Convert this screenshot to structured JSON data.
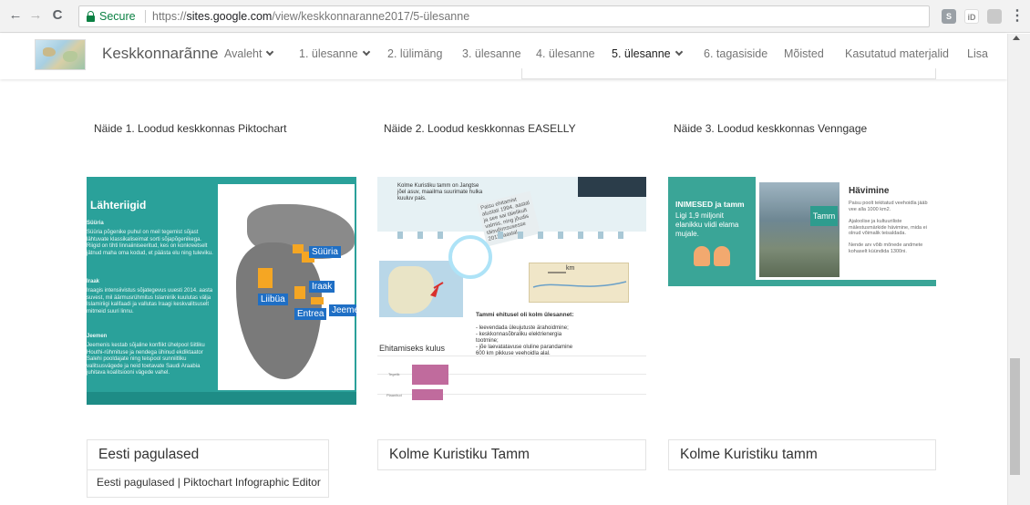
{
  "browser": {
    "back_glyph": "←",
    "forward_glyph": "→",
    "reload_glyph": "C",
    "secure_label": "Secure",
    "url_scheme": "https://",
    "url_host": "sites.google.com",
    "url_path": "/view/keskkonnaranne2017/5-ülesanne",
    "star_glyph": "☆",
    "ext1_label": "S",
    "ext2_label": "iD",
    "ext3_label": "",
    "menu_glyph": "⋮"
  },
  "site": {
    "title": "Keskkonnarãnne",
    "nav": [
      {
        "label": "Avaleht",
        "has_dropdown": true
      },
      {
        "label": "1. ülesanne",
        "has_dropdown": true
      },
      {
        "label": "2. lülimäng",
        "has_dropdown": false
      },
      {
        "label": "3. ülesanne",
        "has_dropdown": false
      },
      {
        "label": "4. ülesanne",
        "has_dropdown": false
      },
      {
        "label": "5. ülesanne",
        "has_dropdown": true,
        "active": true
      },
      {
        "label": "6. tagasiside",
        "has_dropdown": false
      },
      {
        "label": "Mõisted",
        "has_dropdown": false
      },
      {
        "label": "Kasutatud materjalid",
        "has_dropdown": false
      },
      {
        "label": "Lisa",
        "has_dropdown": false
      }
    ]
  },
  "examples": [
    {
      "caption": "Näide 1. Loodud keskkonnas Piktochart",
      "card_title": "Eesti pagulased",
      "card_subtitle": "Eesti pagulased | Piktochart Infographic Editor"
    },
    {
      "caption": "Näide 2. Loodud keskkonnas EASELLY",
      "card_title": "Kolme Kuristiku Tamm"
    },
    {
      "caption": "Näide 3. Loodud keskkonnas Venngage",
      "card_title": "Kolme Kuristiku tamm"
    }
  ],
  "infographic1": {
    "heading": "Lähteriigid",
    "sections": [
      {
        "title": "Süüria",
        "text": "Süüria põgenike puhul on meil tegemist sõjast lähtuvate klassikaliseimat sorti sõjapõgenikega. Riigid on tihti linnaiiniseeritud, kes on konkreetselt jätnud maha oma kodud, et päästa elu ning tuleviku."
      },
      {
        "title": "Iraak",
        "text": "Iraagis intensiivistus sõjategevus uuesti 2014. aasta suvest, mil äärmusrühmitus Islamiriik kuulutas välja Islamiriigi kalifaadi ja vallutas Iraagi keskvalitsuselt mitmeid suuri linnu."
      },
      {
        "title": "Jeemen",
        "text": "Jeemenis kestab sõjaline konflikt ühelpool šiitliku Houthi-rühmituse ja nendega ühinud ekdiktaator Salehi pooldajate ning teispool sunniitliku valitsusvägede ja neid toetavate Saudi Araabia juhitava koalitsiooni vägede vahel."
      }
    ],
    "map_labels": [
      "Süüria",
      "Iraak",
      "Liibüa",
      "Entrea",
      "Jeemen"
    ]
  },
  "infographic2": {
    "top_text": "Kolme Kuristiku tamm on Jangtse jõel asuv, maailma suurimate hulka kuuluv pais.",
    "note_text": "Paisu ehitamist alustati 1994. aastal ja see sai täielikult valmis, ning jõudis täisvõimsusesse 2012. aastal.",
    "map_label": "km",
    "tasks_heading": "Tammi ehitusel oli kolm ülesannet:",
    "tasks": [
      "- leevendada üleujutuste ärahoidmine;",
      "- keskkonnasõbraliku elektrienergia tootmine;",
      "- jõe laevatatavuse oluline parandamine 600 km pikkuse veehoidla alal."
    ],
    "cost_label": "Ehitamiseks kulus",
    "bar_labels": [
      "Tegelik",
      "Plaanitud"
    ]
  },
  "infographic3": {
    "left_title": "INIMESED ja tamm",
    "left_text": "Ligi 1,9 miljonit elanikku viidi elama mujale.",
    "photo_tag": "Tamm",
    "right_title": "Hävimine",
    "right_paragraphs": [
      "Paisu poolt tekitatud veehoidla jääb vee alla 1000 km2.",
      "Ajaloolise ja kultuuriliste mälestusmärkide hävimine, mida ei olnud võimalik teisaldada.",
      "Nende arv võib mõnede andmete kohaselt küündida 1300ni."
    ]
  },
  "colors": {
    "teal": "#2aa19a",
    "venngage_teal": "#3aa597",
    "secure_green": "#0b8043",
    "map_label_blue": "#1f6fc5",
    "highlight_orange": "#f5a623",
    "bar_pink": "#c06b9d"
  }
}
